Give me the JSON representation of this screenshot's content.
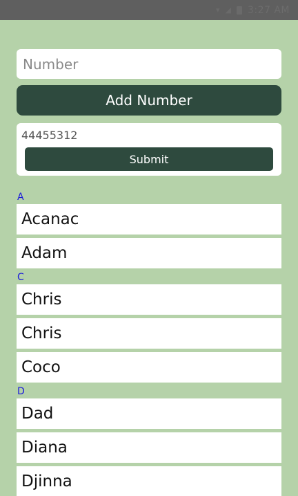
{
  "status_bar": {
    "time": "3:27 AM"
  },
  "form": {
    "number_placeholder": "Number",
    "number_value": "",
    "add_number_label": "Add Number"
  },
  "submit_card": {
    "value": "44455312",
    "submit_label": "Submit"
  },
  "contacts": {
    "sections": [
      {
        "letter": "A",
        "names": [
          "Acanac",
          "Adam"
        ]
      },
      {
        "letter": "C",
        "names": [
          "Chris",
          "Chris",
          "Coco"
        ]
      },
      {
        "letter": "D",
        "names": [
          "Dad",
          "Diana",
          "Djinna"
        ]
      }
    ]
  },
  "colors": {
    "background": "#b5d2a9",
    "button": "#2e4a3e",
    "section_header": "#1a1adb",
    "status_bar": "#5f5f5f"
  }
}
